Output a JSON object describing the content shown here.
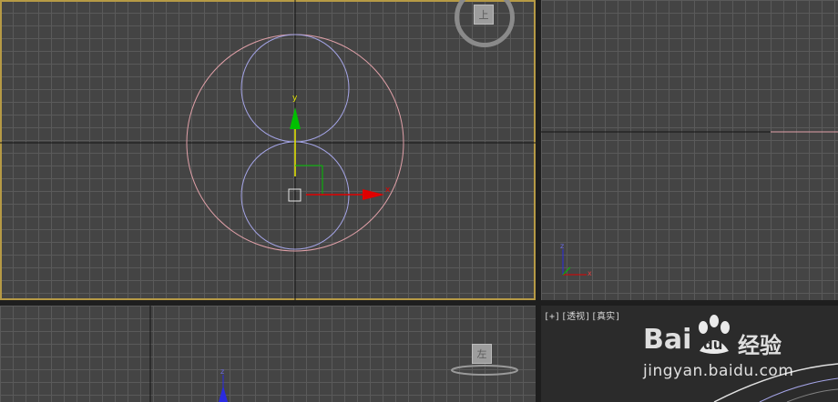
{
  "viewports": {
    "top": {
      "viewcube_label": "上",
      "gizmo": {
        "y_label": "y",
        "x_label": "x"
      }
    },
    "front": {
      "axis_triad": {
        "z_label": "z",
        "x_label": "x"
      }
    },
    "left": {
      "viewcube_label": "左",
      "axis_triad": {
        "z_label": "z"
      }
    },
    "perspective": {
      "menu_plus": "[+]",
      "menu_view": "[透视]",
      "menu_shading": "[真实]"
    }
  },
  "watermark": {
    "brand_text": "Bai",
    "brand_suffix": "du",
    "service_text": "经验",
    "url": "jingyan.baidu.com"
  },
  "colors": {
    "grid_bg": "#444444",
    "active_border": "#b69a45",
    "outer_circle": "#e0a0a8",
    "inner_circles": "#a4a4e6",
    "axis_y": "#00c000",
    "axis_x": "#e00000",
    "axis_z": "#2a2ae0"
  }
}
